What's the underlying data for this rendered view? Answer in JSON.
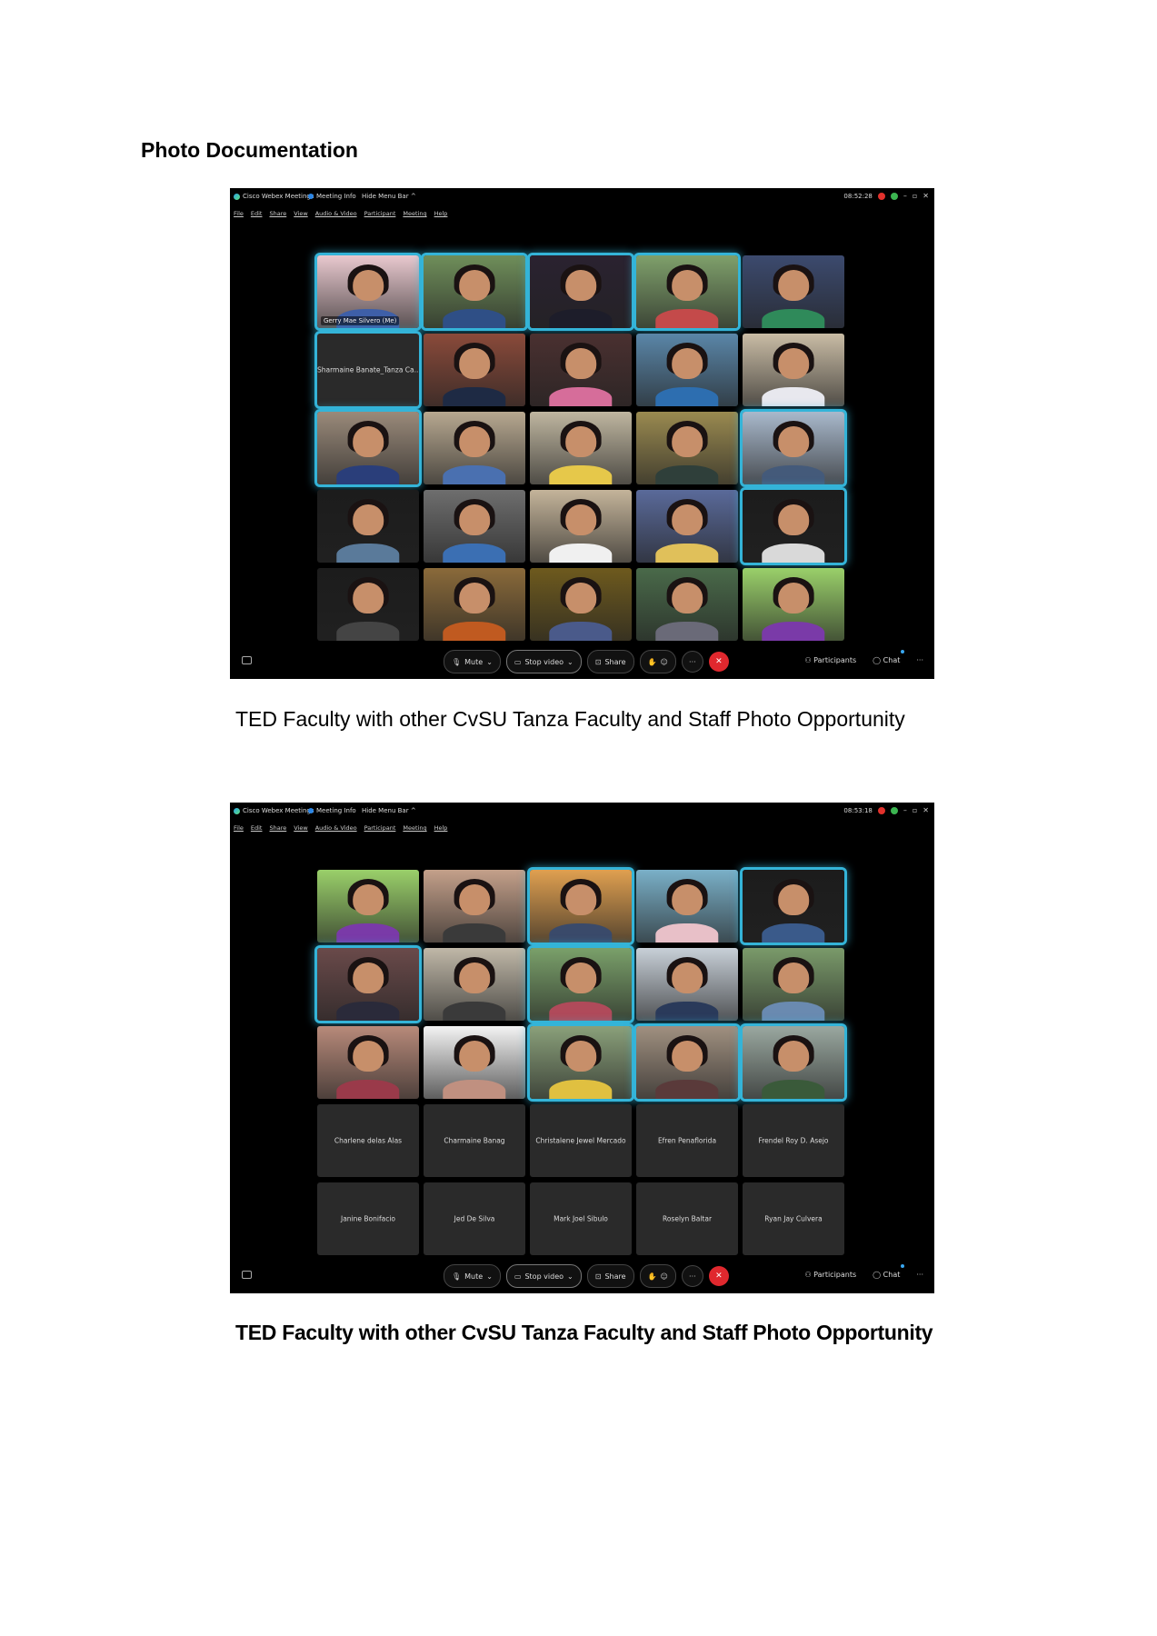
{
  "page": {
    "heading": "Photo Documentation"
  },
  "screenshots": [
    {
      "app_name": "Cisco Webex Meetings",
      "meeting_info": "Meeting Info",
      "hide_menu": "Hide Menu Bar ^",
      "clock": "08:52:28",
      "menu": [
        "File",
        "Edit",
        "Share",
        "View",
        "Audio & Video",
        "Participant",
        "Meeting",
        "Help"
      ],
      "controls": {
        "mute": "Mute",
        "video": "Stop video",
        "share": "Share",
        "participants": "Participants",
        "chat": "Chat"
      },
      "tiles": [
        {
          "type": "video",
          "label": "Gerry Mae Silvero (Me)",
          "highlight": true,
          "bg": "#e9c9cf",
          "shirt": "#3e5fa8"
        },
        {
          "type": "video",
          "highlight": true,
          "bg": "#6f8e5a",
          "shirt": "#2f4f86"
        },
        {
          "type": "video",
          "highlight": true,
          "bg": "#2a2230",
          "shirt": "#1d1d2a"
        },
        {
          "type": "video",
          "highlight": true,
          "bg": "#7fa06b",
          "shirt": "#c44a4a"
        },
        {
          "type": "video",
          "highlight": false,
          "bg": "#3c4a6e",
          "shirt": "#2f8a5a"
        },
        {
          "type": "name",
          "name": "Sharmaine Banate_Tanza Ca...",
          "highlight": true
        },
        {
          "type": "video",
          "highlight": false,
          "bg": "#8a4a3a",
          "shirt": "#1e2a44"
        },
        {
          "type": "video",
          "highlight": false,
          "bg": "#4a3030",
          "shirt": "#d66d9a"
        },
        {
          "type": "video",
          "highlight": false,
          "bg": "#5a86a8",
          "shirt": "#2d6eb0"
        },
        {
          "type": "video",
          "highlight": false,
          "bg": "#c9bca5",
          "shirt": "#e8e8ee"
        },
        {
          "type": "video",
          "highlight": true,
          "bg": "#9a8a7a",
          "shirt": "#2a3e7a"
        },
        {
          "type": "video",
          "highlight": false,
          "bg": "#b7a890",
          "shirt": "#4a70b0"
        },
        {
          "type": "video",
          "highlight": false,
          "bg": "#bfb6a0",
          "shirt": "#e6c84a"
        },
        {
          "type": "video",
          "highlight": false,
          "bg": "#9a8a50",
          "shirt": "#2f3f3a"
        },
        {
          "type": "video",
          "highlight": true,
          "bg": "#a9b9cc",
          "shirt": "#445a7a"
        },
        {
          "type": "video",
          "highlight": false,
          "bg": "#1c1c1c",
          "shirt": "#5a7a9a"
        },
        {
          "type": "video",
          "highlight": false,
          "bg": "#6e6e6e",
          "shirt": "#3b6fb3"
        },
        {
          "type": "video",
          "highlight": false,
          "bg": "#c4b49a",
          "shirt": "#f0f0f0"
        },
        {
          "type": "video",
          "highlight": false,
          "bg": "#5a6a9a",
          "shirt": "#e0c05a"
        },
        {
          "type": "video",
          "highlight": true,
          "bg": "#1c1c1c",
          "shirt": "#d9d9d9"
        },
        {
          "type": "video",
          "highlight": false,
          "bg": "#1c1c1c",
          "shirt": "#444"
        },
        {
          "type": "video",
          "highlight": false,
          "bg": "#8a6a3a",
          "shirt": "#c05a20"
        },
        {
          "type": "video",
          "highlight": false,
          "bg": "#6e5a1e",
          "shirt": "#4a5a8a"
        },
        {
          "type": "video",
          "highlight": false,
          "bg": "#4a6a4a",
          "shirt": "#6a6a78"
        },
        {
          "type": "video",
          "highlight": false,
          "bg": "#9ad06a",
          "shirt": "#7a3aa8"
        }
      ]
    },
    {
      "app_name": "Cisco Webex Meetings",
      "meeting_info": "Meeting Info",
      "hide_menu": "Hide Menu Bar ^",
      "clock": "08:53:18",
      "menu": [
        "File",
        "Edit",
        "Share",
        "View",
        "Audio & Video",
        "Participant",
        "Meeting",
        "Help"
      ],
      "controls": {
        "mute": "Mute",
        "video": "Stop video",
        "share": "Share",
        "participants": "Participants",
        "chat": "Chat"
      },
      "tiles": [
        {
          "type": "video",
          "highlight": false,
          "bg": "#9ad06a",
          "shirt": "#7a3aa8"
        },
        {
          "type": "video",
          "highlight": false,
          "bg": "#c4a08a",
          "shirt": "#3a3a3a"
        },
        {
          "type": "video",
          "highlight": true,
          "bg": "#e0a050",
          "shirt": "#3a4a6a"
        },
        {
          "type": "video",
          "highlight": false,
          "bg": "#7ab0c8",
          "shirt": "#e8c0c8"
        },
        {
          "type": "video",
          "highlight": true,
          "bg": "#1c1c1c",
          "shirt": "#3a5a8a"
        },
        {
          "type": "video",
          "highlight": true,
          "bg": "#6a4a4a",
          "shirt": "#2a2a3a"
        },
        {
          "type": "video",
          "highlight": false,
          "bg": "#c0b8a8",
          "shirt": "#3a3a3a"
        },
        {
          "type": "video",
          "highlight": true,
          "bg": "#7aa06a",
          "shirt": "#b04a5a"
        },
        {
          "type": "video",
          "highlight": false,
          "bg": "#c8d0d8",
          "shirt": "#2a3a5a"
        },
        {
          "type": "video",
          "highlight": false,
          "bg": "#7a9a6a",
          "shirt": "#6a8ab0"
        },
        {
          "type": "video",
          "highlight": false,
          "bg": "#b88a7a",
          "shirt": "#9a3a4a"
        },
        {
          "type": "video",
          "highlight": false,
          "bg": "#f4f4f4",
          "shirt": "#c09080"
        },
        {
          "type": "video",
          "highlight": true,
          "bg": "#8aa07a",
          "shirt": "#e0c040"
        },
        {
          "type": "video",
          "highlight": true,
          "bg": "#a09080",
          "shirt": "#5a3a3a"
        },
        {
          "type": "video",
          "highlight": true,
          "bg": "#9aa8a0",
          "shirt": "#3a5a3a"
        },
        {
          "type": "name",
          "name": "Charlene delas Alas",
          "highlight": false
        },
        {
          "type": "name",
          "name": "Charmaine Banag",
          "highlight": false
        },
        {
          "type": "name",
          "name": "Christalene Jewel Mercado",
          "highlight": false
        },
        {
          "type": "name",
          "name": "Efren Penaflorida",
          "highlight": false
        },
        {
          "type": "name",
          "name": "Frendel Roy D. Asejo",
          "highlight": false
        },
        {
          "type": "name",
          "name": "Janine Bonifacio",
          "highlight": false
        },
        {
          "type": "name",
          "name": "Jed De Silva",
          "highlight": false
        },
        {
          "type": "name",
          "name": "Mark Joel Sibulo",
          "highlight": false
        },
        {
          "type": "name",
          "name": "Roselyn Baltar",
          "highlight": false
        },
        {
          "type": "name",
          "name": "Ryan Jay Culvera",
          "highlight": false
        }
      ]
    }
  ],
  "captions": {
    "first": "TED Faculty with other CvSU Tanza Faculty and Staff Photo Opportunity",
    "second": "TED Faculty with other CvSU Tanza Faculty and Staff Photo Opportunity"
  }
}
